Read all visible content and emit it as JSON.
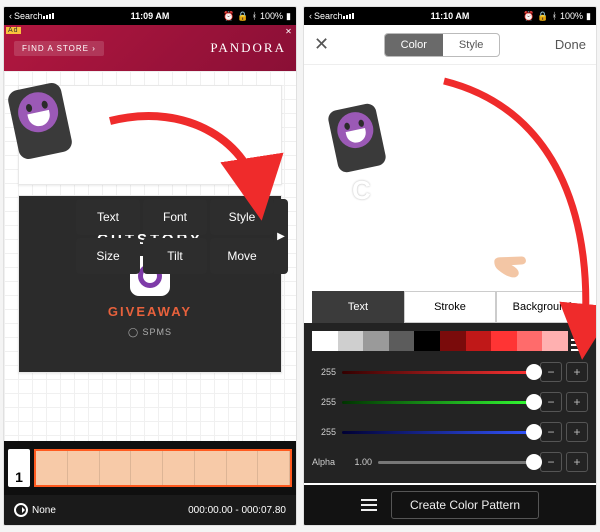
{
  "status": {
    "back_label": "Search",
    "time_left": "11:09 AM",
    "time_right": "11:10 AM",
    "battery": "100%"
  },
  "ad": {
    "cta": "FIND A STORE ›",
    "brand": "PANDORA",
    "tag": "Ad"
  },
  "popup": {
    "items": [
      "Text",
      "Font",
      "Style",
      "Size",
      "Tilt",
      "Move"
    ]
  },
  "promo": {
    "title": "CUTSTORY",
    "sub": "GIVEAWAY",
    "credit": "◯ SPMS"
  },
  "timeline": {
    "index": "1",
    "undo": "None",
    "range": "000:00.00 - 000:07.80"
  },
  "right_header": {
    "seg": [
      "Color",
      "Style"
    ],
    "done": "Done"
  },
  "preview_text": "C",
  "fill_tabs": [
    "Text",
    "Stroke",
    "Background"
  ],
  "swatches": [
    "#ffffff",
    "#cfcfcf",
    "#9a9a9a",
    "#5c5c5c",
    "#000000",
    "#7a0b0b",
    "#c01818",
    "#ff3434",
    "#ff6b6b",
    "#ffb0b0"
  ],
  "sliders": {
    "r": "255",
    "g": "255",
    "b": "255",
    "alpha_label": "Alpha",
    "alpha": "1.00"
  },
  "pattern_btn": "Create Color Pattern"
}
